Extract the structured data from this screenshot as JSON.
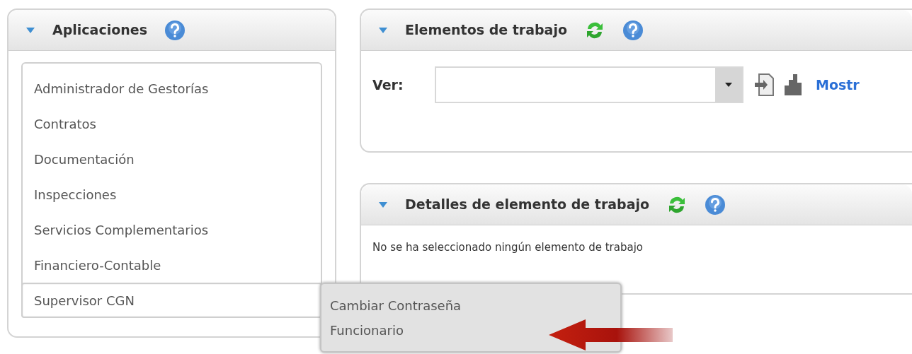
{
  "applications": {
    "title": "Aplicaciones",
    "expanded": true,
    "items": [
      {
        "label": "Administrador de Gestorías",
        "selected": false
      },
      {
        "label": "Contratos",
        "selected": false
      },
      {
        "label": "Documentación",
        "selected": false
      },
      {
        "label": "Inspecciones",
        "selected": false
      },
      {
        "label": "Servicios Complementarios",
        "selected": false
      },
      {
        "label": "Financiero-Contable",
        "selected": false
      },
      {
        "label": "Supervisor CGN",
        "selected": true
      }
    ]
  },
  "work_items": {
    "title": "Elementos de trabajo",
    "expanded": true,
    "view_label": "Ver:",
    "link": "Mostr"
  },
  "work_item_details": {
    "title": "Detalles de elemento de trabajo",
    "expanded": true,
    "message": "No se ha seleccionado ningún elemento de trabajo"
  },
  "submenu": {
    "items": [
      "Cambiar Contraseña",
      "Funcionario"
    ]
  }
}
